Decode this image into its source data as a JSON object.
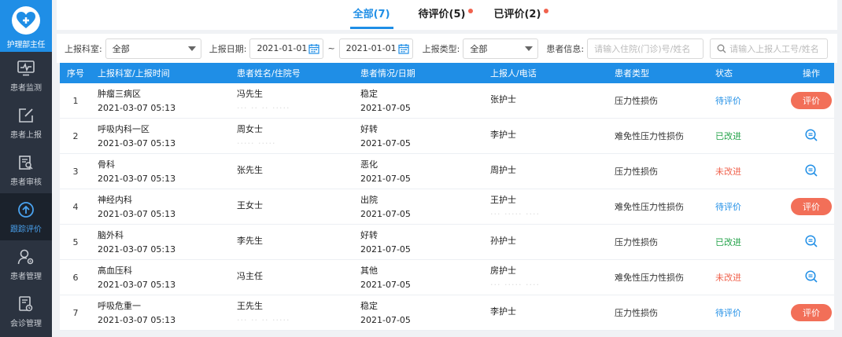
{
  "app": {
    "role": "护理部主任"
  },
  "sidebar": {
    "items": [
      {
        "label": "患者监测",
        "icon": "monitor-icon"
      },
      {
        "label": "患者上报",
        "icon": "edit-icon"
      },
      {
        "label": "患者审核",
        "icon": "audit-icon"
      },
      {
        "label": "跟踪评价",
        "icon": "track-icon",
        "active": true
      },
      {
        "label": "患者管理",
        "icon": "user-gear-icon"
      },
      {
        "label": "会诊管理",
        "icon": "consult-icon"
      }
    ]
  },
  "tabs": [
    {
      "label": "全部(7)",
      "active": true,
      "dot": false
    },
    {
      "label": "待评价(5)",
      "active": false,
      "dot": true
    },
    {
      "label": "已评价(2)",
      "active": false,
      "dot": true
    }
  ],
  "filters": {
    "dept_label": "上报科室:",
    "dept_value": "全部",
    "date_label": "上报日期:",
    "date_from": "2021-01-01",
    "date_sep": "~",
    "date_to": "2021-01-01",
    "type_label": "上报类型:",
    "type_value": "全部",
    "patient_label": "患者信息:",
    "patient_placeholder": "请输入住院(门诊)号/姓名",
    "reporter_placeholder": "请输入上报人工号/姓名"
  },
  "table": {
    "headers": [
      "序号",
      "上报科室/上报时间",
      "患者姓名/住院号",
      "患者情况/日期",
      "上报人/电话",
      "患者类型",
      "状态",
      "操作"
    ],
    "rows": [
      {
        "no": "1",
        "dept": "肿瘤三病区",
        "time": "2021-03-07 05:13",
        "patient": "冯先生",
        "pid": "··· ·· ·· ·····",
        "cond": "稳定",
        "date": "2021-07-05",
        "reporter": "张护士",
        "phone": "",
        "type": "压力性损伤",
        "status": "待评价",
        "status_kind": "pending",
        "action": "评价"
      },
      {
        "no": "2",
        "dept": "呼吸内科一区",
        "time": "2021-03-07 05:13",
        "patient": "周女士",
        "pid": "·····  ·····",
        "cond": "好转",
        "date": "2021-07-05",
        "reporter": "李护士",
        "phone": "",
        "type": "难免性压力性损伤",
        "status": "已改进",
        "status_kind": "improved",
        "action": ""
      },
      {
        "no": "3",
        "dept": "骨科",
        "time": "2021-03-07 05:13",
        "patient": "张先生",
        "pid": "",
        "cond": "恶化",
        "date": "2021-07-05",
        "reporter": "周护士",
        "phone": "",
        "type": "压力性损伤",
        "status": "未改进",
        "status_kind": "not",
        "action": ""
      },
      {
        "no": "4",
        "dept": "神经内科",
        "time": "2021-03-07 05:13",
        "patient": "王女士",
        "pid": "",
        "cond": "出院",
        "date": "2021-07-05",
        "reporter": "王护士",
        "phone": "··· ·····  ····",
        "type": "难免性压力性损伤",
        "status": "待评价",
        "status_kind": "pending",
        "action": "评价"
      },
      {
        "no": "5",
        "dept": "脑外科",
        "time": "2021-03-07 05:13",
        "patient": "李先生",
        "pid": "",
        "cond": "好转",
        "date": "2021-07-05",
        "reporter": "孙护士",
        "phone": "",
        "type": "压力性损伤",
        "status": "已改进",
        "status_kind": "improved",
        "action": ""
      },
      {
        "no": "6",
        "dept": "高血压科",
        "time": "2021-03-07 05:13",
        "patient": "冯主任",
        "pid": "",
        "cond": "其他",
        "date": "2021-07-05",
        "reporter": "房护士",
        "phone": "··· ·····  ····",
        "type": "难免性压力性损伤",
        "status": "未改进",
        "status_kind": "not",
        "action": ""
      },
      {
        "no": "7",
        "dept": "呼吸危重一",
        "time": "2021-03-07 05:13",
        "patient": "王先生",
        "pid": "··· ·· ·· ·····",
        "cond": "稳定",
        "date": "2021-07-05",
        "reporter": "李护士",
        "phone": "",
        "type": "压力性损伤",
        "status": "待评价",
        "status_kind": "pending",
        "action": "评价"
      }
    ]
  },
  "colors": {
    "primary": "#1f8ee6",
    "sidebar": "#2b3340",
    "danger": "#f0624d",
    "success": "#24a34a"
  }
}
